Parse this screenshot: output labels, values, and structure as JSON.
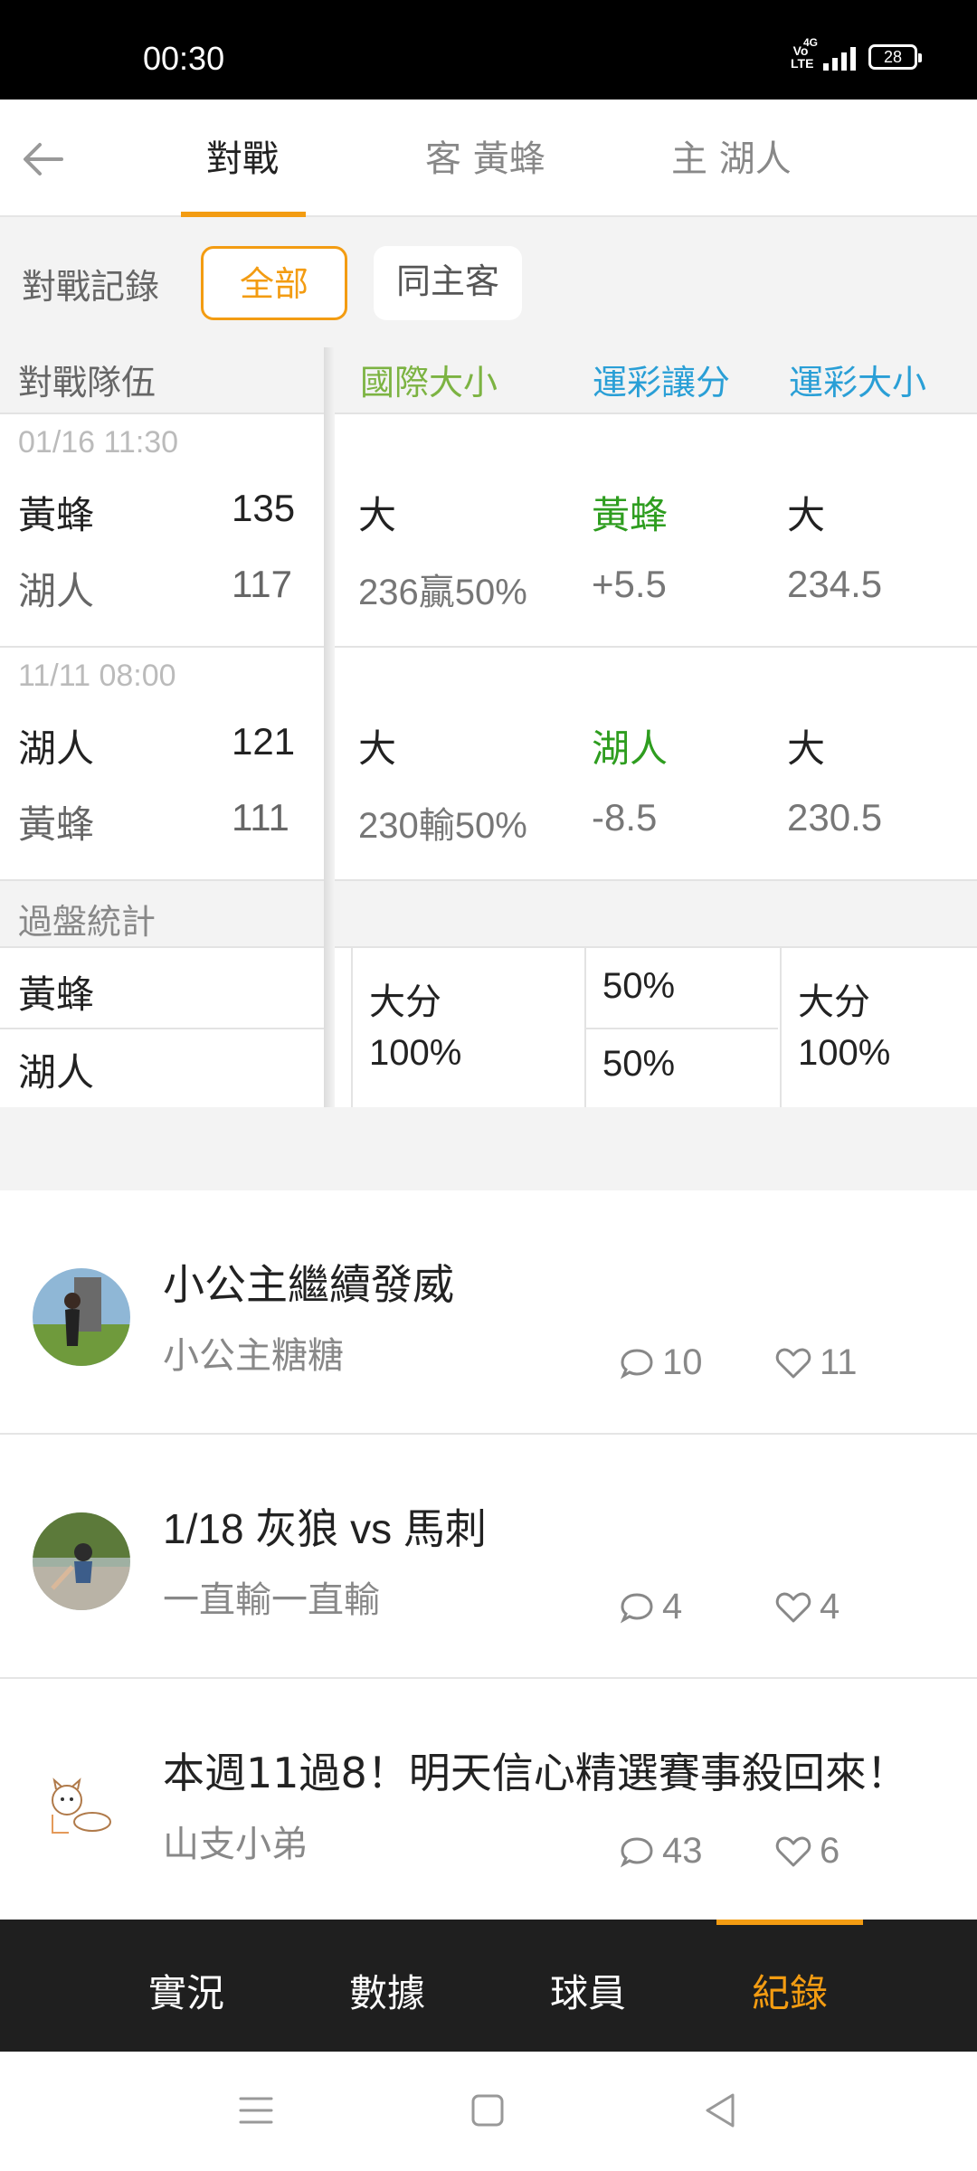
{
  "status": {
    "time": "00:30",
    "volte": "Vo LTE",
    "network": "4G",
    "battery": "28"
  },
  "tabs": [
    {
      "label": "對戰",
      "active": true
    },
    {
      "label": "客 黃蜂",
      "active": false
    },
    {
      "label": "主 湖人",
      "active": false
    }
  ],
  "filter": {
    "label": "對戰記錄",
    "options": [
      "全部",
      "同主客"
    ],
    "selected": "全部"
  },
  "table": {
    "headers": {
      "team": "對戰隊伍",
      "intl_ou": "國際大小",
      "lottery_spread": "運彩讓分",
      "lottery_ou": "運彩大小"
    },
    "matches": [
      {
        "date": "01/16 11:30",
        "team1": "黃蜂",
        "score1": "135",
        "team2": "湖人",
        "score2": "117",
        "intl_result": "大",
        "intl_line": "236贏50%",
        "spread_team": "黃蜂",
        "spread_line": "+5.5",
        "ou_result": "大",
        "ou_line": "234.5"
      },
      {
        "date": "11/11 08:00",
        "team1": "湖人",
        "score1": "121",
        "team2": "黃蜂",
        "score2": "111",
        "intl_result": "大",
        "intl_line": "230輸50%",
        "spread_team": "湖人",
        "spread_line": "-8.5",
        "ou_result": "大",
        "ou_line": "230.5"
      }
    ],
    "stats": {
      "title": "過盤統計",
      "team1": "黃蜂",
      "team2": "湖人",
      "intl_label": "大分",
      "intl_pct": "100%",
      "spread_pct1": "50%",
      "spread_pct2": "50%",
      "ou_label": "大分",
      "ou_pct": "100%"
    }
  },
  "posts": [
    {
      "title": "小公主繼續發威",
      "author": "小公主糖糖",
      "comments": "10",
      "likes": "11"
    },
    {
      "title": "1/18 灰狼 vs 馬刺",
      "author": "一直輸一直輸",
      "comments": "4",
      "likes": "4"
    },
    {
      "title": "本週11過8！明天信心精選賽事殺回來！",
      "author": "山支小弟",
      "comments": "43",
      "likes": "6"
    }
  ],
  "bottom_nav": [
    {
      "label": "實況",
      "active": false
    },
    {
      "label": "數據",
      "active": false
    },
    {
      "label": "球員",
      "active": false
    },
    {
      "label": "紀錄",
      "active": true
    }
  ],
  "colors": {
    "accent": "#f39c12",
    "intl_header": "#7cb342",
    "lottery_header": "#2a9fd6",
    "win_green": "#2e9d1f"
  },
  "icons": [
    "back-arrow-icon",
    "comment-icon",
    "heart-icon",
    "menu-icon",
    "home-square-icon",
    "back-triangle-icon"
  ]
}
